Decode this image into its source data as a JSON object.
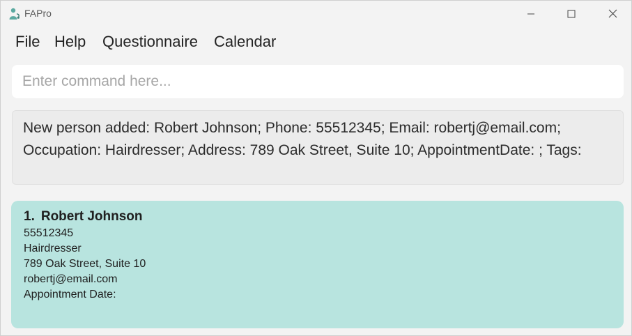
{
  "window": {
    "title": "FAPro",
    "icons": {
      "app": "stethoscope-person-icon",
      "minimize": "minimize-icon",
      "maximize": "maximize-icon",
      "close": "close-icon"
    }
  },
  "menu": {
    "file": "File",
    "help": "Help",
    "questionnaire": "Questionnaire",
    "calendar": "Calendar"
  },
  "command": {
    "placeholder": "Enter command here...",
    "value": ""
  },
  "result": {
    "text": "New person added: Robert Johnson; Phone: 55512345; Email: robertj@email.com; Occupation: Hairdresser; Address: 789 Oak Street, Suite 10; AppointmentDate: ; Tags:"
  },
  "persons": [
    {
      "index": "1.",
      "name": "Robert Johnson",
      "phone": "55512345",
      "occupation": "Hairdresser",
      "address": "789 Oak Street, Suite 10",
      "email": "robertj@email.com",
      "appointment": "Appointment Date:"
    }
  ],
  "colors": {
    "card": "#b8e4df",
    "background": "#f3f3f3",
    "accent": "#5aa9a0"
  }
}
